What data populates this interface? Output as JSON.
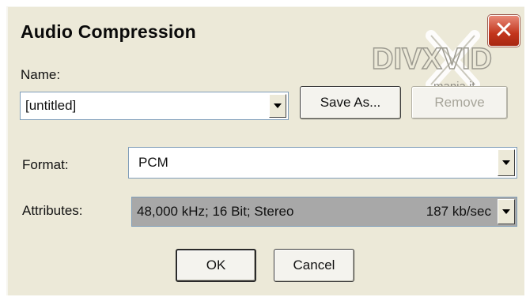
{
  "dialog": {
    "title": "Audio Compression",
    "close_glyph": "✕"
  },
  "watermark": {
    "brand_text": "DIVXVID",
    "sub_text": "mania.it"
  },
  "name_section": {
    "label": "Name:",
    "value": "[untitled]",
    "save_as_label": "Save As...",
    "remove_label": "Remove"
  },
  "format": {
    "label": "Format:",
    "value": "PCM"
  },
  "attributes": {
    "label": "Attributes:",
    "value": "48,000 kHz; 16 Bit; Stereo",
    "rate": "187 kb/sec"
  },
  "buttons": {
    "ok_label": "OK",
    "cancel_label": "Cancel"
  },
  "colors": {
    "window_bg": "#ece9d8",
    "close_red": "#c2351c",
    "field_border": "#7f9db9",
    "attributes_bg": "#a8a8a8"
  },
  "icons": [
    "close-icon",
    "chevron-down-icon"
  ]
}
